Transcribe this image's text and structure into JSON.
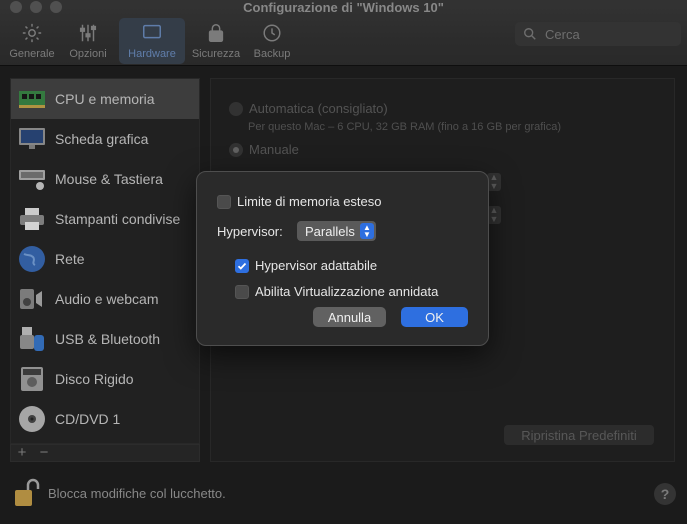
{
  "window": {
    "title": "Configurazione di \"Windows 10\""
  },
  "toolbar": {
    "items": [
      {
        "label": "Generale",
        "icon": "gear-icon"
      },
      {
        "label": "Opzioni",
        "icon": "sliders-icon"
      },
      {
        "label": "Hardware",
        "icon": "monitor-icon",
        "active": true
      },
      {
        "label": "Sicurezza",
        "icon": "lock-icon"
      },
      {
        "label": "Backup",
        "icon": "clock-icon"
      }
    ]
  },
  "search": {
    "placeholder": "Cerca"
  },
  "sidebar": {
    "items": [
      {
        "label": "CPU e memoria",
        "icon": "memory-chip-icon",
        "selected": true
      },
      {
        "label": "Scheda grafica",
        "icon": "display-icon"
      },
      {
        "label": "Mouse & Tastiera",
        "icon": "keyboard-mouse-icon"
      },
      {
        "label": "Stampanti condivise",
        "icon": "printer-icon"
      },
      {
        "label": "Rete",
        "icon": "globe-icon"
      },
      {
        "label": "Audio e webcam",
        "icon": "speaker-icon"
      },
      {
        "label": "USB & Bluetooth",
        "icon": "usb-icon"
      },
      {
        "label": "Disco Rigido",
        "icon": "hard-disk-icon"
      },
      {
        "label": "CD/DVD 1",
        "icon": "cd-icon"
      }
    ],
    "add_label": "+",
    "remove_label": "−"
  },
  "main": {
    "auto_label": "Automatica (consigliato)",
    "auto_sub": "Per questo Mac – 6 CPU, 32 GB RAM (fino a 16 GB per grafica)",
    "manual_label": "Manuale",
    "restore_label": "Ripristina Predefiniti"
  },
  "footer": {
    "lock_label": "Blocca modifiche col lucchetto.",
    "help_label": "?"
  },
  "dialog": {
    "extended_memory_label": "Limite di memoria esteso",
    "extended_memory_checked": false,
    "hypervisor_label": "Hypervisor:",
    "hypervisor_value": "Parallels",
    "adaptive_label": "Hypervisor adattabile",
    "adaptive_checked": true,
    "nested_label": "Abilita Virtualizzazione annidata",
    "nested_checked": false,
    "cancel_label": "Annulla",
    "ok_label": "OK"
  },
  "colors": {
    "accent": "#2e6fe0",
    "background": "#1f1f1f"
  }
}
